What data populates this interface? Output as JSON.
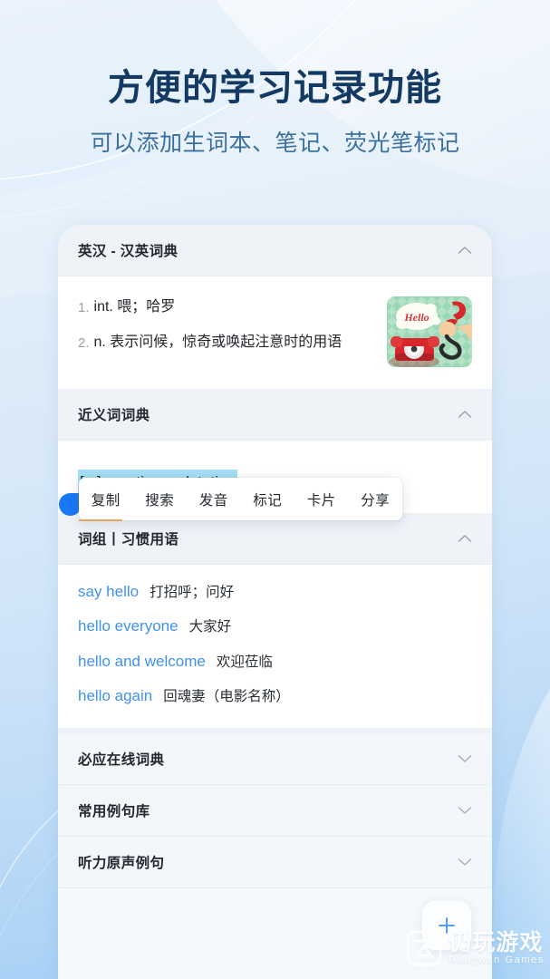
{
  "hero": {
    "title": "方便的学习记录功能",
    "subtitle": "可以添加生词本、笔记、荧光笔标记"
  },
  "sections": {
    "dictionary": {
      "title": "英汉 - 汉英词典",
      "chevron": "chevron-up-icon",
      "definitions": [
        {
          "num": "1.",
          "text": "int. 喂；哈罗"
        },
        {
          "num": "2.",
          "text": "n. 表示问候，惊奇或唤起注意时的用语"
        }
      ],
      "image_caption": "Hello"
    },
    "synonyms": {
      "title": "近义词词典",
      "chevron": "chevron-up-icon",
      "selected_text": "[n.] greeting, salutation"
    },
    "phrases": {
      "title": "词组丨习惯用语",
      "chevron": "chevron-up-icon",
      "items": [
        {
          "en": "say hello",
          "zh": "打招呼；问好"
        },
        {
          "en": "hello everyone",
          "zh": "大家好"
        },
        {
          "en": "hello and welcome",
          "zh": "欢迎莅临"
        },
        {
          "en": "hello again",
          "zh": "回魂妻（电影名称）"
        }
      ]
    },
    "collapsed": [
      {
        "title": "必应在线词典",
        "chevron": "chevron-down-icon"
      },
      {
        "title": "常用例句库",
        "chevron": "chevron-down-icon"
      },
      {
        "title": "听力原声例句",
        "chevron": "chevron-down-icon"
      }
    ]
  },
  "context_menu": {
    "items": [
      "复制",
      "搜索",
      "发音",
      "标记",
      "卡片",
      "分享"
    ]
  },
  "fab": {
    "icon": "plus-icon"
  },
  "watermark": {
    "cn": "仍玩游戏",
    "en": "Rengwan Games"
  },
  "colors": {
    "accent_blue": "#3f92f0",
    "handle_blue": "#1878f5",
    "highlight": "#a5def5",
    "title_navy": "#143a64",
    "subtitle_blue": "#3a6f9e",
    "underline_orange": "#e8a760"
  }
}
